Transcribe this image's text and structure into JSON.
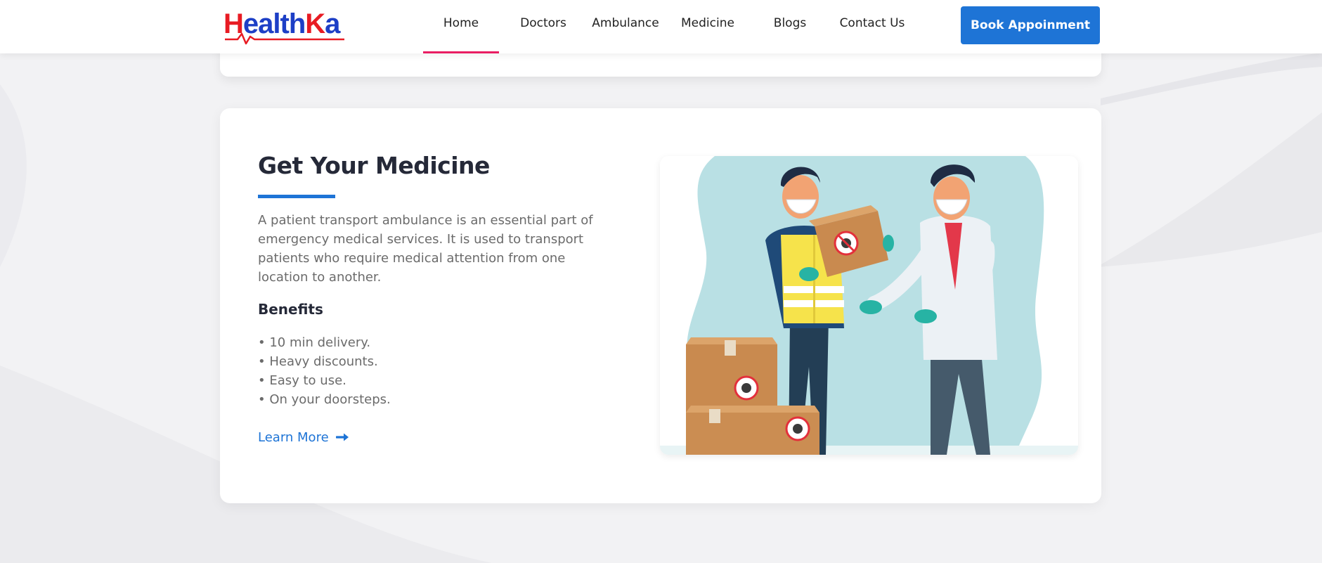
{
  "header": {
    "logo": {
      "part1": "H",
      "part2": "ealth",
      "part3": "K",
      "part4": "a"
    },
    "nav": [
      {
        "label": "Home",
        "active": true
      },
      {
        "label": "Doctors",
        "active": false
      },
      {
        "label": "Ambulance",
        "active": false
      },
      {
        "label": "Medicine",
        "active": false
      },
      {
        "label": "Blogs",
        "active": false
      },
      {
        "label": "Contact Us",
        "active": false
      }
    ],
    "book_button": "Book Appoinment"
  },
  "section": {
    "title": "Get Your Medicine",
    "description": "A patient transport ambulance is an essential part of emergency medical services. It is used to transport patients who require medical attention from one location to another.",
    "benefits_title": "Benefits",
    "benefits": [
      "10 min delivery.",
      "Heavy discounts.",
      "Easy to use.",
      "On your doorsteps."
    ],
    "learn_more": "Learn More",
    "illustration": "medicine-delivery-illustration"
  },
  "colors": {
    "brand_blue": "#1e74d6",
    "logo_blue": "#1d3fc6",
    "logo_red": "#e81b23",
    "active_nav_underline": "#e91e63",
    "heading": "#252938",
    "body_text": "#6b6b6b"
  }
}
